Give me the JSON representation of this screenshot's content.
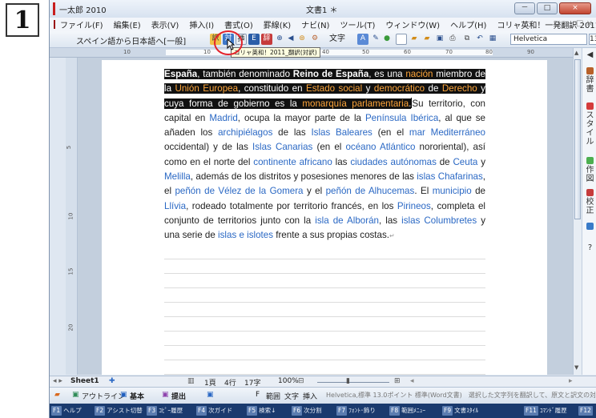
{
  "step_number": "1",
  "app": {
    "title": "一太郎 2010",
    "document_title": "文書1 ＊"
  },
  "window_controls": [
    "－",
    "□",
    "×"
  ],
  "menu": [
    "ファイル(F)",
    "編集(E)",
    "表示(V)",
    "挿入(I)",
    "書式(O)",
    "罫線(K)",
    "ナビ(N)",
    "ツール(T)",
    "ウィンドウ(W)",
    "ヘルプ(H)",
    "コリャ英和！一発翻訳 2011(X)"
  ],
  "toolbar": {
    "direction": "スペイン語から日本語へ[一般]",
    "text_button": "文字",
    "font": "Helvetica",
    "size": "13"
  },
  "tooltip": "コリャ英和！2011_翻訳(対訳)",
  "ruler_marks": [
    "10",
    "10",
    "40",
    "50",
    "60",
    "70",
    "80",
    "90"
  ],
  "vruler_marks": [
    "5",
    "10",
    "15",
    "20"
  ],
  "document": {
    "segments": [
      {
        "t": "España",
        "s": "hb"
      },
      {
        "t": ", también denominado ",
        "s": "h"
      },
      {
        "t": "Reino de España",
        "s": "hb"
      },
      {
        "t": ", es una ",
        "s": "h"
      },
      {
        "t": "nación",
        "s": "hl"
      },
      {
        "t": " miembro de la ",
        "s": "h"
      },
      {
        "t": "Unión Europea",
        "s": "hl"
      },
      {
        "t": ", constituido en ",
        "s": "h"
      },
      {
        "t": "Estado social",
        "s": "hl"
      },
      {
        "t": " y ",
        "s": "h"
      },
      {
        "t": "democrático",
        "s": "hl"
      },
      {
        "t": " de ",
        "s": "h"
      },
      {
        "t": "Derecho",
        "s": "hl"
      },
      {
        "t": " y cuya forma de gobierno es la ",
        "s": "h"
      },
      {
        "t": "monarquía parlamentaria",
        "s": "hl"
      },
      {
        "t": ".",
        "s": "h"
      },
      {
        "t": "",
        "s": "caret"
      },
      {
        "t": "Su territorio, con capital en ",
        "s": "n"
      },
      {
        "t": "Madrid",
        "s": "l"
      },
      {
        "t": ", ocupa la mayor parte de la ",
        "s": "n"
      },
      {
        "t": "Península Ibérica",
        "s": "l"
      },
      {
        "t": ", al que se añaden los ",
        "s": "n"
      },
      {
        "t": "archipiélagos",
        "s": "l"
      },
      {
        "t": " de las ",
        "s": "n"
      },
      {
        "t": "Islas Baleares",
        "s": "l"
      },
      {
        "t": " (en el ",
        "s": "n"
      },
      {
        "t": "mar Mediterráneo",
        "s": "l"
      },
      {
        "t": " occidental) y de las ",
        "s": "n"
      },
      {
        "t": "Islas Canarias",
        "s": "l"
      },
      {
        "t": " (en el ",
        "s": "n"
      },
      {
        "t": "océano Atlántico",
        "s": "l"
      },
      {
        "t": " nororiental), así como en el norte del ",
        "s": "n"
      },
      {
        "t": "continente africano",
        "s": "l"
      },
      {
        "t": " las ",
        "s": "n"
      },
      {
        "t": "ciudades autónomas",
        "s": "l"
      },
      {
        "t": " de ",
        "s": "n"
      },
      {
        "t": "Ceuta",
        "s": "l"
      },
      {
        "t": " y ",
        "s": "n"
      },
      {
        "t": "Melilla",
        "s": "l"
      },
      {
        "t": ", además de los distritos y posesiones menores de las ",
        "s": "n"
      },
      {
        "t": "islas Chafarinas",
        "s": "l"
      },
      {
        "t": ", el ",
        "s": "n"
      },
      {
        "t": "peñón de Vélez de la Gomera",
        "s": "l"
      },
      {
        "t": " y el ",
        "s": "n"
      },
      {
        "t": "peñón de Alhucemas",
        "s": "l"
      },
      {
        "t": ". El ",
        "s": "n"
      },
      {
        "t": "municipio",
        "s": "l"
      },
      {
        "t": " de ",
        "s": "n"
      },
      {
        "t": "Llívia",
        "s": "l"
      },
      {
        "t": ", rodeado totalmente por territorio francés, en los ",
        "s": "n"
      },
      {
        "t": "Pirineos",
        "s": "l"
      },
      {
        "t": ", completa el conjunto de territorios junto con la ",
        "s": "n"
      },
      {
        "t": "isla de Alborán",
        "s": "l"
      },
      {
        "t": ", las ",
        "s": "n"
      },
      {
        "t": "islas Columbretes",
        "s": "l"
      },
      {
        "t": " y una serie de ",
        "s": "n"
      },
      {
        "t": "islas e islotes",
        "s": "l"
      },
      {
        "t": " frente a sus propias costas.",
        "s": "n"
      },
      {
        "t": "↵",
        "s": "mark"
      }
    ]
  },
  "right_panel": [
    "辞書",
    "スタイル",
    "作図",
    "校正",
    "?"
  ],
  "sheetbar": {
    "sheet": "Sheet1",
    "page": "1頁",
    "line": "4行",
    "col": "17字",
    "zoom": "100%"
  },
  "bottom": {
    "outline": "アウトライン",
    "basic": "基本",
    "submit": "提出",
    "f_range": "F",
    "range": "範囲",
    "char": "文字",
    "insert": "挿入",
    "status": "Helvetica,標準 13.0ポイント 標準(Word文書)　選択した文字列を翻訳して、原文と訳文の対訳"
  },
  "fkeys": [
    {
      "k": "F1",
      "l": "ヘルプ"
    },
    {
      "k": "F2",
      "l": "アシスト切替"
    },
    {
      "k": "F3",
      "l": "ｺﾋﾟｰ履歴"
    },
    {
      "k": "F4",
      "l": "次ガイド"
    },
    {
      "k": "F5",
      "l": "検索↓"
    },
    {
      "k": "F6",
      "l": "次分割"
    },
    {
      "k": "F7",
      "l": "ﾌｫﾝﾄ･飾り"
    },
    {
      "k": "F8",
      "l": "範囲ﾒﾆｭｰ"
    },
    {
      "k": "F9",
      "l": "文書ｽﾀｲﾙ"
    },
    {
      "k": "F11",
      "l": "ｺﾏﾝﾄﾞ履歴"
    },
    {
      "k": "F12",
      "l": ""
    }
  ],
  "colors": {
    "link": "#2a68c4",
    "highlight_link": "#ffa63a",
    "selection": "#111111",
    "callout": "#e3232b"
  }
}
